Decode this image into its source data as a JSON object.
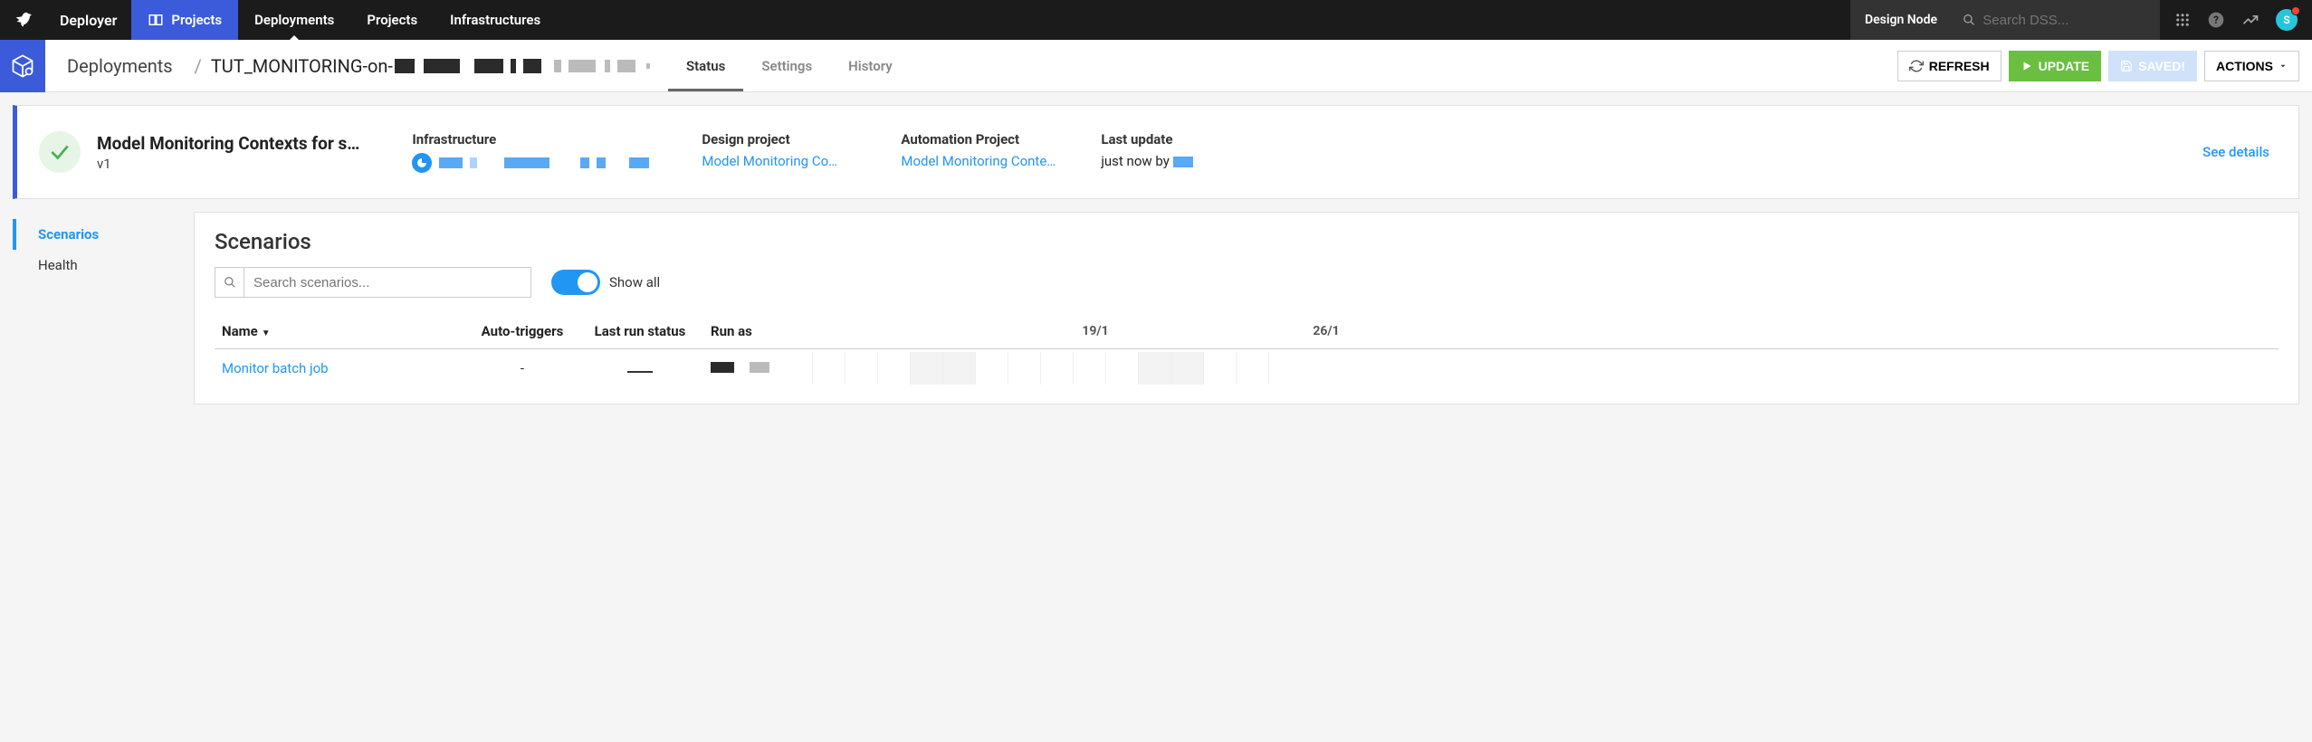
{
  "topbar": {
    "deployer_label": "Deployer",
    "projects_label": "Projects",
    "nav": {
      "deployments": "Deployments",
      "projects": "Projects",
      "infra": "Infrastructures"
    },
    "design_node": "Design Node",
    "search_placeholder": "Search DSS...",
    "avatar_initial": "S"
  },
  "subheader": {
    "crumb_deployments": "Deployments",
    "deployment_id_prefix": "TUT_MONITORING-on-",
    "tabs": {
      "status": "Status",
      "settings": "Settings",
      "history": "History"
    },
    "buttons": {
      "refresh": "REFRESH",
      "update": "UPDATE",
      "saved": "SAVED!",
      "actions": "ACTIONS"
    }
  },
  "summary": {
    "title": "Model Monitoring Contexts for s…",
    "version": "v1",
    "cols": {
      "infra_label": "Infrastructure",
      "design_label": "Design project",
      "design_value": "Model Monitoring Co…",
      "auto_label": "Automation Project",
      "auto_value": "Model Monitoring Conte…",
      "update_label": "Last update",
      "update_value": "just now by "
    },
    "see_details": "See details"
  },
  "sidenav": {
    "scenarios": "Scenarios",
    "health": "Health"
  },
  "panel": {
    "title": "Scenarios",
    "search_placeholder": "Search scenarios...",
    "showall_label": "Show all",
    "columns": {
      "name": "Name",
      "auto": "Auto-triggers",
      "lastrun": "Last run status",
      "runas": "Run as"
    },
    "cal_dates": [
      "19/1",
      "26/1"
    ],
    "rows": [
      {
        "name": "Monitor batch job",
        "auto": "-"
      }
    ]
  }
}
